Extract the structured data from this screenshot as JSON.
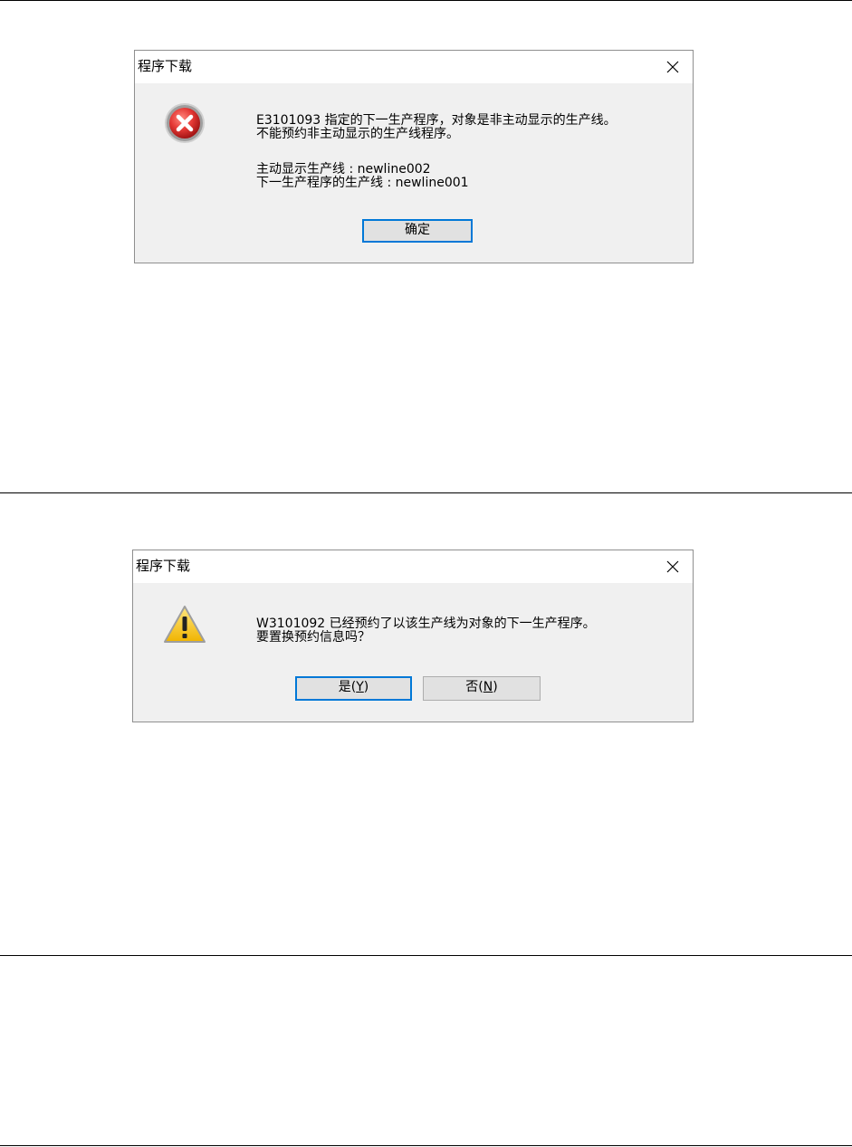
{
  "dialogs": [
    {
      "title": "程序下载",
      "icon": "error-icon",
      "lines": [
        "E3101093 指定的下一生产程序，对象是非主动显示的生产线。",
        "不能预约非主动显示的生产线程序。",
        "",
        "主动显示生产线 : newline002",
        "下一生产程序的生产线 : newline001"
      ],
      "buttons": {
        "ok": "确定"
      }
    },
    {
      "title": "程序下载",
      "icon": "warning-icon",
      "lines": [
        "W3101092 已经预约了以该生产线为对象的下一生产程序。",
        "要置换预约信息吗？"
      ],
      "buttons": {
        "yes_prefix": "是(",
        "yes_key": "Y",
        "yes_suffix": ")",
        "no_prefix": "否(",
        "no_key": "N",
        "no_suffix": ")"
      }
    }
  ],
  "colors": {
    "dialog_bg": "#f0f0f0",
    "titlebar_bg": "#ffffff",
    "default_button_border": "#0078d7",
    "error_red": "#d32f2f",
    "warning_yellow": "#f7c843"
  }
}
